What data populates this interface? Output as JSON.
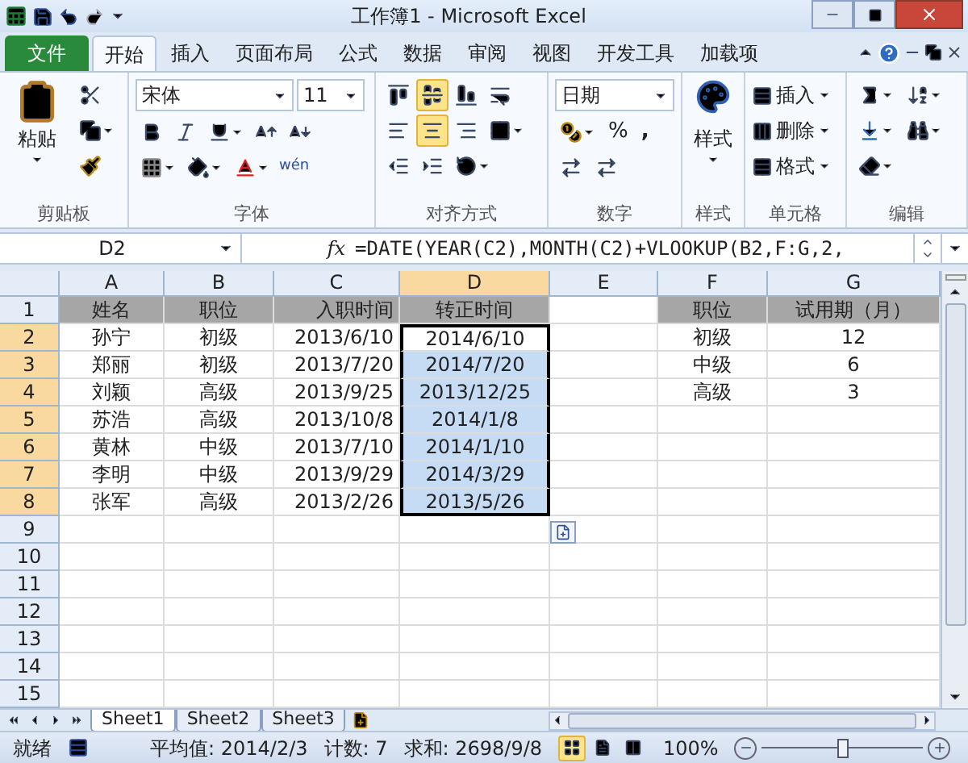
{
  "window": {
    "title": "工作簿1 - Microsoft Excel"
  },
  "tabs": [
    {
      "label": "文件",
      "kind": "file",
      "selected": false
    },
    {
      "label": "开始",
      "kind": "tab",
      "selected": true
    },
    {
      "label": "插入",
      "kind": "tab",
      "selected": false
    },
    {
      "label": "页面布局",
      "kind": "tab",
      "selected": false
    },
    {
      "label": "公式",
      "kind": "tab",
      "selected": false
    },
    {
      "label": "数据",
      "kind": "tab",
      "selected": false
    },
    {
      "label": "审阅",
      "kind": "tab",
      "selected": false
    },
    {
      "label": "视图",
      "kind": "tab",
      "selected": false
    },
    {
      "label": "开发工具",
      "kind": "tab",
      "selected": false
    },
    {
      "label": "加载项",
      "kind": "tab",
      "selected": false
    }
  ],
  "ribbon": {
    "clipboard": {
      "paste": "粘贴",
      "label": "剪贴板"
    },
    "font": {
      "name": "宋体",
      "size": "11",
      "label": "字体",
      "phonetic": "wén"
    },
    "alignment": {
      "label": "对齐方式",
      "vertical": [
        {
          "selected": false
        },
        {
          "selected": true
        },
        {
          "selected": false
        }
      ],
      "horizontal": [
        {
          "selected": false
        },
        {
          "selected": true
        },
        {
          "selected": false
        }
      ]
    },
    "number": {
      "format": "日期",
      "percent": "%",
      "comma": ",",
      "label": "数字"
    },
    "styles": {
      "button": "样式",
      "label": "样式"
    },
    "cells": {
      "items": [
        "插入",
        "删除",
        "格式"
      ],
      "label": "单元格"
    },
    "editing": {
      "label": "编辑"
    }
  },
  "formula_bar": {
    "name_box": "D2",
    "fx": "fx",
    "formula": "=DATE(YEAR(C2),MONTH(C2)+VLOOKUP(B2,F:G,2,"
  },
  "columns": [
    {
      "label": "A",
      "selected": false
    },
    {
      "label": "B",
      "selected": false
    },
    {
      "label": "C",
      "selected": false
    },
    {
      "label": "D",
      "selected": true
    },
    {
      "label": "E",
      "selected": false
    },
    {
      "label": "F",
      "selected": false
    },
    {
      "label": "G",
      "selected": false
    }
  ],
  "rows": [
    {
      "number": "1",
      "kind": "header",
      "selected": false,
      "cells": [
        "姓名",
        "职位",
        "入职时间",
        "转正时间",
        null,
        "职位",
        "试用期（月）"
      ]
    },
    {
      "number": "2",
      "kind": "data",
      "selected": true,
      "active": true,
      "cells": [
        "孙宁",
        "初级",
        "2013/6/10",
        "2014/6/10",
        null,
        "初级",
        "12"
      ]
    },
    {
      "number": "3",
      "kind": "data",
      "selected": true,
      "active": false,
      "cells": [
        "郑丽",
        "初级",
        "2013/7/20",
        "2014/7/20",
        null,
        "中级",
        "6"
      ]
    },
    {
      "number": "4",
      "kind": "data",
      "selected": true,
      "active": false,
      "cells": [
        "刘颖",
        "高级",
        "2013/9/25",
        "2013/12/25",
        null,
        "高级",
        "3"
      ]
    },
    {
      "number": "5",
      "kind": "data",
      "selected": true,
      "active": false,
      "cells": [
        "苏浩",
        "高级",
        "2013/10/8",
        "2014/1/8"
      ]
    },
    {
      "number": "6",
      "kind": "data",
      "selected": true,
      "active": false,
      "cells": [
        "黄林",
        "中级",
        "2013/7/10",
        "2014/1/10"
      ]
    },
    {
      "number": "7",
      "kind": "data",
      "selected": true,
      "active": false,
      "cells": [
        "李明",
        "中级",
        "2013/9/29",
        "2014/3/29"
      ]
    },
    {
      "number": "8",
      "kind": "data",
      "selected": true,
      "active": false,
      "cells": [
        "张军",
        "高级",
        "2013/2/26",
        "2013/5/26"
      ]
    },
    {
      "number": "9",
      "kind": "data",
      "selected": false
    },
    {
      "number": "10",
      "kind": "data",
      "selected": false
    },
    {
      "number": "11",
      "kind": "data",
      "selected": false
    },
    {
      "number": "12",
      "kind": "data",
      "selected": false
    },
    {
      "number": "13",
      "kind": "data",
      "selected": false
    },
    {
      "number": "14",
      "kind": "data",
      "selected": false
    },
    {
      "number": "15",
      "kind": "data",
      "selected": false
    }
  ],
  "sheets": [
    {
      "label": "Sheet1",
      "selected": true
    },
    {
      "label": "Sheet2",
      "selected": false
    },
    {
      "label": "Sheet3",
      "selected": false
    }
  ],
  "status_bar": {
    "state": "就绪",
    "average": "平均值: 2014/2/3",
    "count": "计数: 7",
    "sum": "求和: 2698/9/8",
    "views": [
      {
        "kind": "normal",
        "selected": true
      },
      {
        "kind": "layout",
        "selected": false
      },
      {
        "kind": "break",
        "selected": false
      }
    ],
    "zoom": "100%",
    "zoom_level": {
      "level": 0.5
    }
  }
}
